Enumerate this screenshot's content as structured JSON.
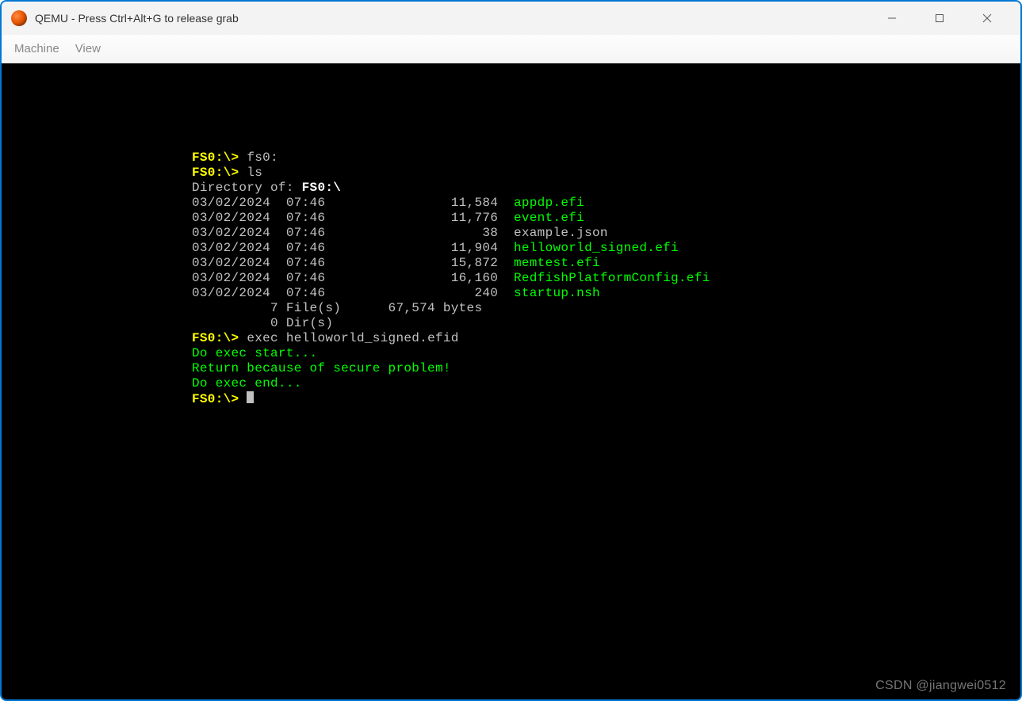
{
  "window": {
    "title": "QEMU - Press Ctrl+Alt+G to release grab"
  },
  "menubar": {
    "items": [
      "Machine",
      "View"
    ]
  },
  "terminal": {
    "prompt": "FS0:\\>",
    "cmd1": "fs0:",
    "cmd2": "ls",
    "dir_label": "Directory of:",
    "dir_path": "FS0:\\",
    "files": [
      {
        "date": "03/02/2024",
        "time": "07:46",
        "size": "11,584",
        "name": "appdp.efi",
        "color": "green"
      },
      {
        "date": "03/02/2024",
        "time": "07:46",
        "size": "11,776",
        "name": "event.efi",
        "color": "green"
      },
      {
        "date": "03/02/2024",
        "time": "07:46",
        "size": "38",
        "name": "example.json",
        "color": "gray"
      },
      {
        "date": "03/02/2024",
        "time": "07:46",
        "size": "11,904",
        "name": "helloworld_signed.efi",
        "color": "green"
      },
      {
        "date": "03/02/2024",
        "time": "07:46",
        "size": "15,872",
        "name": "memtest.efi",
        "color": "green"
      },
      {
        "date": "03/02/2024",
        "time": "07:46",
        "size": "16,160",
        "name": "RedfishPlatformConfig.efi",
        "color": "green"
      },
      {
        "date": "03/02/2024",
        "time": "07:46",
        "size": "240",
        "name": "startup.nsh",
        "color": "green"
      }
    ],
    "summary_files": "          7 File(s)      67,574 bytes",
    "summary_dirs": "          0 Dir(s)",
    "cmd3": "exec helloworld_signed.efid",
    "msg1": "Do exec start...",
    "msg2": "Return because of secure problem!",
    "msg3": "Do exec end..."
  },
  "watermark": "CSDN @jiangwei0512"
}
